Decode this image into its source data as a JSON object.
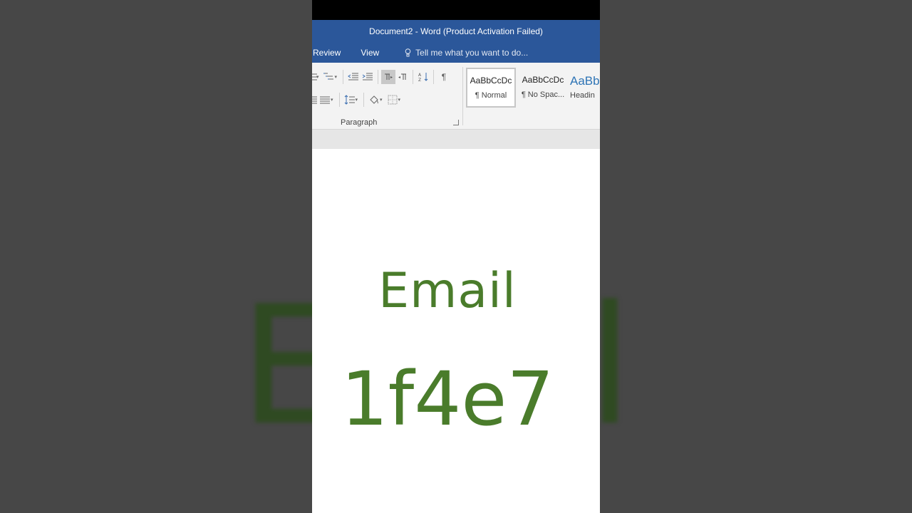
{
  "window": {
    "title": "Document2 - Word (Product Activation Failed)"
  },
  "tabs": [
    {
      "label": "Review"
    },
    {
      "label": "View"
    }
  ],
  "tell_me": {
    "placeholder": "Tell me what you want to do..."
  },
  "ribbon": {
    "group_label": "Paragraph",
    "icons": [
      "numbering-icon",
      "multilevel-list-icon",
      "decrease-indent-icon",
      "increase-indent-icon",
      "ltr-icon",
      "rtl-icon",
      "sort-icon",
      "show-marks-icon",
      "justify-icon",
      "line-spacing-icon",
      "shading-icon",
      "borders-icon"
    ],
    "styles": [
      {
        "sample": "AaBbCcDc",
        "name": "¶ Normal"
      },
      {
        "sample": "AaBbCcDc",
        "name": "¶ No Spac..."
      },
      {
        "sample": "AaBb",
        "name": "Headin"
      }
    ]
  },
  "document": {
    "line1": "Email",
    "line2": "1f4e7",
    "text_color": "#4a7c2b"
  },
  "colors": {
    "title_bar": "#2b579a",
    "backdrop": "#4a4a4a"
  }
}
